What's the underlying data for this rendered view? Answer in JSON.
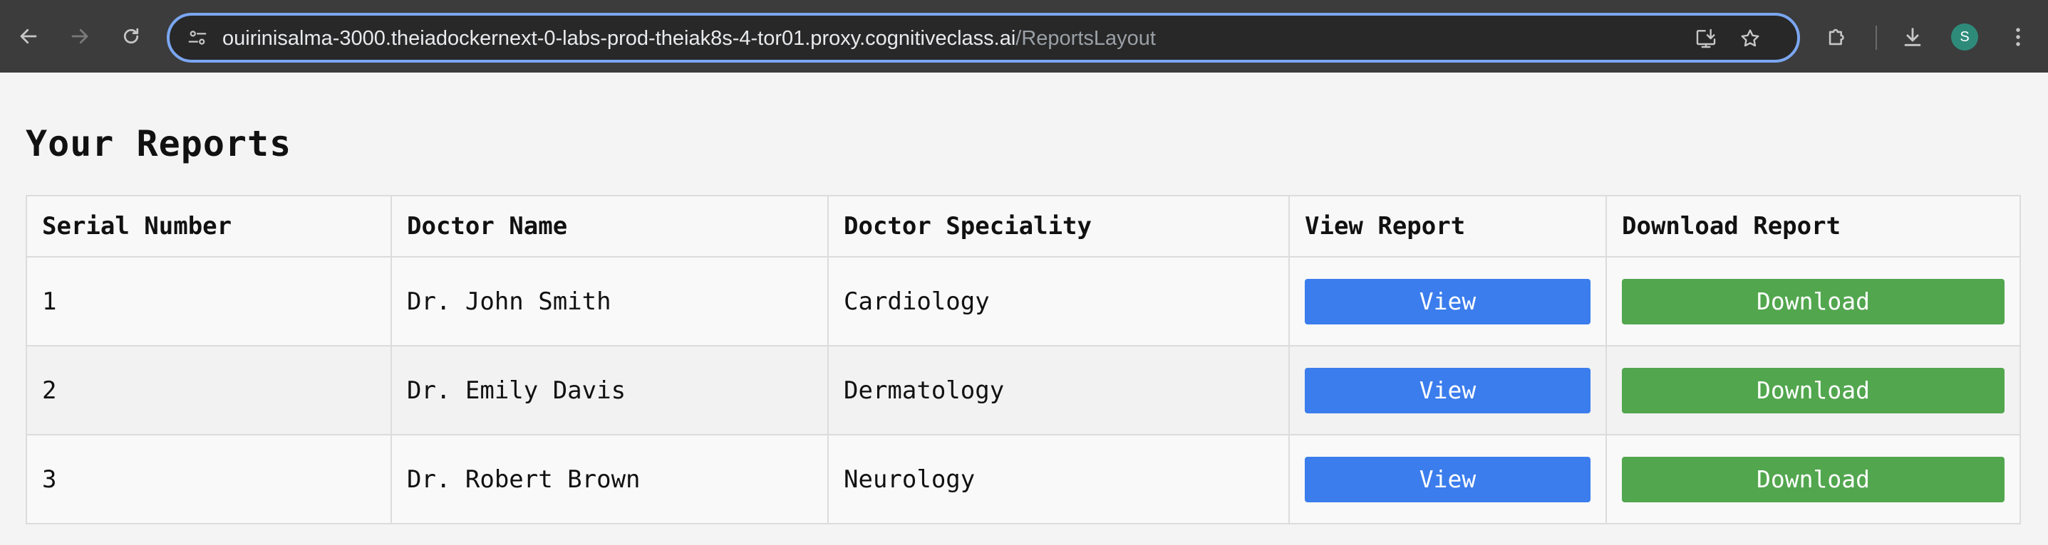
{
  "browser": {
    "url_host": "ouirinisalma-3000.theiadockernext-0-labs-prod-theiak8s-4-tor01.proxy.cognitiveclass.ai",
    "url_path": "/ReportsLayout",
    "profile_initial": "S",
    "icons": {
      "back": "arrow-left-icon",
      "forward": "arrow-right-icon",
      "reload": "reload-icon",
      "site_info": "tune-icon",
      "install": "install-app-icon",
      "bookmark": "star-icon",
      "extensions": "puzzle-icon",
      "downloads": "download-icon",
      "menu": "kebab-menu-icon"
    },
    "colors": {
      "toolbar": "#3c3c3c",
      "omnibox_border": "#7ba7f2",
      "avatar": "#2e8b7a"
    }
  },
  "page": {
    "title": "Your Reports",
    "table": {
      "headers": [
        "Serial Number",
        "Doctor Name",
        "Doctor Speciality",
        "View Report",
        "Download Report"
      ],
      "rows": [
        {
          "serial": "1",
          "doctor": "Dr. John Smith",
          "speciality": "Cardiology",
          "view_label": "View",
          "download_label": "Download"
        },
        {
          "serial": "2",
          "doctor": "Dr. Emily Davis",
          "speciality": "Dermatology",
          "view_label": "View",
          "download_label": "Download"
        },
        {
          "serial": "3",
          "doctor": "Dr. Robert Brown",
          "speciality": "Neurology",
          "view_label": "View",
          "download_label": "Download"
        }
      ]
    },
    "colors": {
      "view_button": "#3b7ded",
      "download_button": "#52a64e",
      "background": "#f4f4f4"
    }
  }
}
